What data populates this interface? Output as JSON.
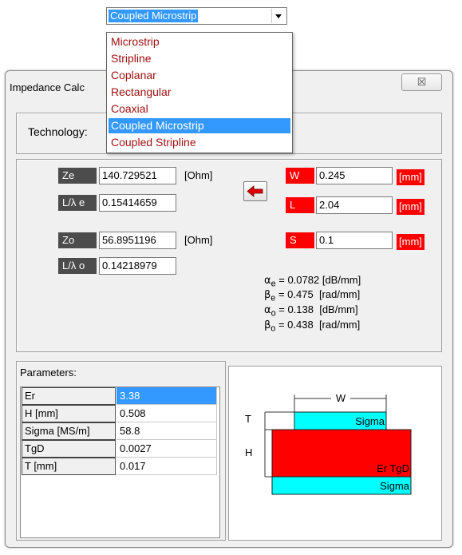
{
  "top_select": {
    "value": "Coupled Microstrip"
  },
  "dropdown": {
    "items": [
      "Microstrip",
      "Stripline",
      "Coplanar",
      "Rectangular",
      "Coaxial",
      "Coupled Microstrip",
      "Coupled Stripline"
    ],
    "selected_index": 5
  },
  "window": {
    "title": "Impedance Calc",
    "close_glyph": "☒"
  },
  "technology": {
    "label": "Technology:"
  },
  "even": {
    "z_label": "Ze",
    "z_value": "140.729521",
    "z_unit": "[Ohm]",
    "l_label": "L/λ e",
    "l_value": "0.15414659"
  },
  "odd": {
    "z_label": "Zo",
    "z_value": "56.8951196",
    "z_unit": "[Ohm]",
    "l_label": "L/λ o",
    "l_value": "0.14218979"
  },
  "geometry": {
    "w_label": "W",
    "w_value": "0.245",
    "w_unit": "[mm]",
    "l_label": "L",
    "l_value": "2.04",
    "l_unit": "[mm]",
    "s_label": "S",
    "s_value": "0.1",
    "s_unit": "[mm]"
  },
  "results": [
    {
      "sym": "α",
      "sub": "e",
      "value": "= 0.0782",
      "unit": "[dB/mm]"
    },
    {
      "sym": "β",
      "sub": "e",
      "value": "= 0.475",
      "unit": "[rad/mm]"
    },
    {
      "sym": "α",
      "sub": "o",
      "value": "= 0.138",
      "unit": "[dB/mm]"
    },
    {
      "sym": "β",
      "sub": "o",
      "value": "= 0.438",
      "unit": "[rad/mm]"
    }
  ],
  "parameters": {
    "label": "Parameters:",
    "rows": [
      {
        "name": "Er",
        "value": "3.38"
      },
      {
        "name": "H [mm]",
        "value": "0.508"
      },
      {
        "name": "Sigma [MS/m]",
        "value": "58.8"
      },
      {
        "name": "TgD",
        "value": "0.0027"
      },
      {
        "name": "T [mm]",
        "value": "0.017"
      }
    ]
  },
  "diagram": {
    "w_label": "W",
    "t_label": "T",
    "h_label": "H",
    "top_conductor_label": "Sigma",
    "substrate_label": "Er TgD",
    "ground_label": "Sigma",
    "conductor_color": "#00ffff",
    "substrate_color": "#ff0000"
  },
  "colors": {
    "selection": "#3399ff",
    "accent_red": "#ff0000",
    "list_text": "#a01010"
  }
}
